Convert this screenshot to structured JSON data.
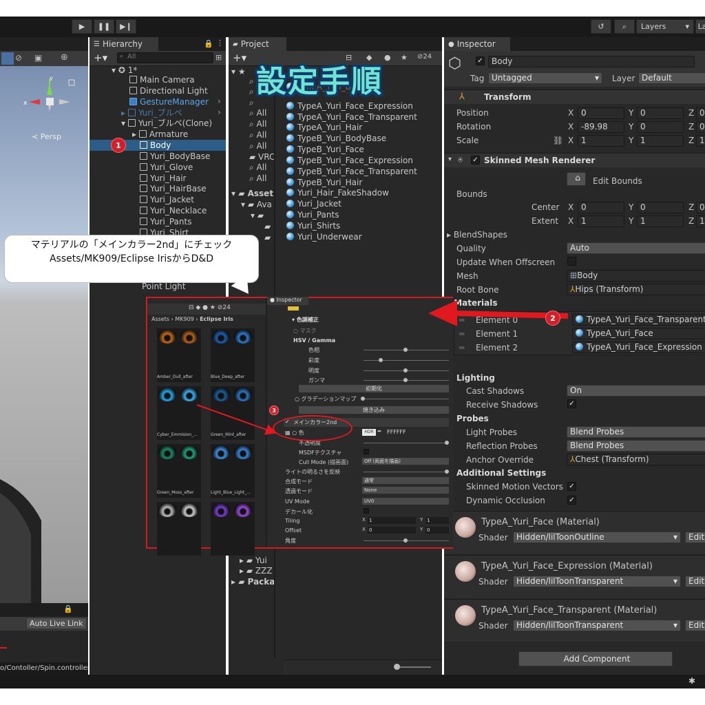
{
  "overlay": {
    "title": "設定手順",
    "callout_line1": "マテリアルの「メインカラー2nd」にチェック",
    "callout_line2": "Assets/MK909/Eclipse IrisからD&D",
    "badge1": "1",
    "badge2": "2",
    "badge3": "3"
  },
  "toolbar": {
    "layers_label": "Layers",
    "layout_label": "La"
  },
  "scene": {
    "persp_label": "≺ Persp",
    "auto_live_link": "Auto Live Link",
    "controller_path": "o/Contoller/Spin.controller"
  },
  "hierarchy": {
    "tab": "Hierarchy",
    "search_placeholder": "All",
    "scene_name": "1*",
    "items": [
      {
        "label": "Main Camera"
      },
      {
        "label": "Directional Light"
      },
      {
        "label": "GestureManager"
      },
      {
        "label": "Yuri_ブルペ"
      },
      {
        "label": "Yuri_ブルペ(Clone)"
      },
      {
        "label": "Armature"
      },
      {
        "label": "Body"
      },
      {
        "label": "Yuri_BodyBase"
      },
      {
        "label": "Yuri_Glove"
      },
      {
        "label": "Yuri_Hair"
      },
      {
        "label": "Yuri_HairBase"
      },
      {
        "label": "Yuri_Jacket"
      },
      {
        "label": "Yuri_Necklace"
      },
      {
        "label": "Yuri_Pants"
      },
      {
        "label": "Yuri_Shirt"
      }
    ],
    "point_light": "Point Light"
  },
  "project": {
    "tab": "Project",
    "count": "24",
    "left_items": [
      "All",
      "All",
      "All",
      "All",
      "VRC",
      "All",
      "All"
    ],
    "assets_label": "Asset",
    "ava_label": "Ava",
    "bottom_items": [
      "Yui",
      "ZZZ",
      "Packa"
    ],
    "files": [
      "TypeA_Yuri_Face_Expression",
      "TypeA_Yuri_Face_Transparent",
      "TypeA_Yuri_Hair",
      "TypeB_Yuri_BodyBase",
      "TypeB_Yuri_Face",
      "TypeB_Yuri_Face_Expression",
      "TypeB_Yuri_Face_Transparent",
      "TypeB_Yuri_Hair",
      "Yuri_Hair_FakeShadow",
      "Yuri_Jacket",
      "Yuri_Pants",
      "Yuri_Shirts",
      "Yuri_Underwear"
    ]
  },
  "inset": {
    "breadcrumb": [
      "Assets",
      "MK909",
      "Eclipse Iris"
    ],
    "count": "24",
    "inspector_tab": "Inspector",
    "eyes": [
      {
        "label": "Amber_Dull_after",
        "color": "#c46a1a"
      },
      {
        "label": "",
        "color": "#b3641c"
      },
      {
        "label": "Blue_Deep_after",
        "color": "#1c5fb0"
      },
      {
        "label": "",
        "color": "#2f7ad0"
      },
      {
        "label": "Cyber_Emmision_...",
        "color": "#2aa6e8"
      },
      {
        "label": "",
        "color": "#3cb0f0"
      },
      {
        "label": "Green_Mint_after",
        "color": "#1b5f9c"
      },
      {
        "label": "",
        "color": "#2d77c2"
      },
      {
        "label": "Green_Moss_after",
        "color": "#1e8a6a"
      },
      {
        "label": "",
        "color": "#23a07a"
      },
      {
        "label": "Light_Blue_Light_...",
        "color": "#3f8fe0"
      },
      {
        "label": "",
        "color": "#3b86d8"
      },
      {
        "label": "",
        "color": "#bdbdbd"
      },
      {
        "label": "",
        "color": "#cfcfcf"
      },
      {
        "label": "",
        "color": "#7a3fd0"
      },
      {
        "label": "",
        "color": "#9a4ad8"
      }
    ],
    "section_color": "色調補正",
    "mask": "マスク",
    "hsv": "HSV / Gamma",
    "hue": "色相",
    "saturation": "彩度",
    "brightness": "明度",
    "gamma": "ガンマ",
    "init_btn": "初期化",
    "gradation": "グラデーションマップ",
    "bake_btn": "焼き込み",
    "main2nd": "メインカラー2nd",
    "color": "色",
    "hdr": "HDR",
    "hex": "FFFFFF",
    "opacity": "不透明度",
    "msdf": "MSDFテクスチャ",
    "cull_mode": "Cull Mode (描画面)",
    "cull_value": "Off (両面を描画)",
    "light_reflect": "ライトの明るさを反映",
    "blend_mode": "合成モード",
    "blend_value": "通常",
    "transparent_mode": "透過モード",
    "transparent_value": "None",
    "uv_mode": "UV Mode",
    "uv_value": "UV0",
    "decal": "デカール化",
    "tiling": "Tiling",
    "tiling_x": "1",
    "tiling_y": "1",
    "offset": "Offset",
    "offset_x": "0",
    "offset_y": "0",
    "angle": "角度"
  },
  "inspector": {
    "tab": "Inspector",
    "object_name": "Body",
    "tag_label": "Tag",
    "tag_value": "Untagged",
    "layer_label": "Layer",
    "layer_value": "Default",
    "transform": "Transform",
    "position": {
      "label": "Position",
      "x": "0",
      "y": "0",
      "z": "0"
    },
    "rotation": {
      "label": "Rotation",
      "x": "-89.98",
      "y": "0",
      "z": "0"
    },
    "scale": {
      "label": "Scale",
      "x": "1",
      "y": "1",
      "z": "1"
    },
    "smr": "Skinned Mesh Renderer",
    "edit_bounds": "Edit Bounds",
    "bounds": "Bounds",
    "center": {
      "label": "Center",
      "x": "0",
      "y": "0",
      "z": "0"
    },
    "extent": {
      "label": "Extent",
      "x": "1",
      "y": "1",
      "z": "1"
    },
    "blendshapes": "BlendShapes",
    "quality": {
      "label": "Quality",
      "value": "Auto"
    },
    "update_offscreen": "Update When Offscreen",
    "mesh": {
      "label": "Mesh",
      "value": "Body"
    },
    "root_bone": {
      "label": "Root Bone",
      "value": "Hips (Transform)"
    },
    "materials": "Materials",
    "elements": [
      {
        "label": "Element 0",
        "value": "TypeA_Yuri_Face_Transparent"
      },
      {
        "label": "Element 1",
        "value": "TypeA_Yuri_Face"
      },
      {
        "label": "Element 2",
        "value": "TypeA_Yuri_Face_Expression"
      }
    ],
    "lighting": "Lighting",
    "cast_shadows": {
      "label": "Cast Shadows",
      "value": "On"
    },
    "receive_shadows": "Receive Shadows",
    "probes": "Probes",
    "light_probes": {
      "label": "Light Probes",
      "value": "Blend Probes"
    },
    "reflection_probes": {
      "label": "Reflection Probes",
      "value": "Blend Probes"
    },
    "anchor_override": {
      "label": "Anchor Override",
      "value": "Chest (Transform)"
    },
    "additional": "Additional Settings",
    "skinned_motion": "Skinned Motion Vectors",
    "dynamic_occlusion": "Dynamic Occlusion",
    "materials_list": [
      {
        "name": "TypeA_Yuri_Face (Material)",
        "shader": "Hidden/lilToonOutline"
      },
      {
        "name": "TypeA_Yuri_Face_Expression (Material)",
        "shader": "Hidden/lilToonTransparent"
      },
      {
        "name": "TypeA_Yuri_Face_Transparent (Material)",
        "shader": "Hidden/lilToonTransparent"
      }
    ],
    "shader_label": "Shader",
    "edit_label": "Edit...",
    "add_component": "Add Component"
  },
  "colors": {
    "selection": "#2c5d87",
    "badge": "#d0202a",
    "arrow": "#e0181f",
    "title_fill": "#6fe3d4",
    "title_stroke": "#0d3b6b"
  }
}
